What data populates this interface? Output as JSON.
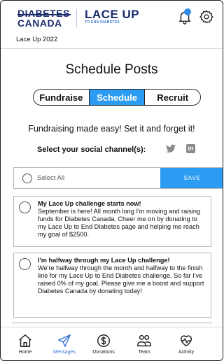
{
  "header": {
    "logo_diabetes_line1": "DIABETES",
    "logo_diabetes_line2": "CANADA",
    "logo_laceup_line1": "LACE UP",
    "logo_laceup_line2": "TO END DIABETES",
    "event_name": "Lace Up 2022",
    "notification_badge": true
  },
  "page": {
    "title": "Schedule Posts",
    "tabs": [
      {
        "label": "Fundraise",
        "active": false
      },
      {
        "label": "Schedule",
        "active": true
      },
      {
        "label": "Recruit",
        "active": false
      }
    ],
    "tagline": "Fundraising made easy! Set it and forget it!",
    "channels_label": "Select your social channel(s):",
    "channels": [
      {
        "icon": "twitter-icon",
        "selected": false
      },
      {
        "icon": "linkedin-icon",
        "label": "in",
        "selected": false
      }
    ]
  },
  "select_bar": {
    "select_all_label": "Select All",
    "save_label": "SAVE"
  },
  "posts": [
    {
      "title": "My Lace Up challenge starts now!",
      "body": "September is here! All month long I'm moving and raising funds for Diabetes Canada. Cheer me on by donating to my Lace Up to End Diabetes page and helping me reach my goal of $2500."
    },
    {
      "title": "I'm halfway through my Lace Up challenge!",
      "body": "We're halfway through the month and halfway to the finish line for my Lace Up to End Diabetes challenge. So far I've raised 0% of my goal. Please give me a boost and support Diabetes Canada by donating today!"
    },
    {
      "title": "",
      "body": ""
    }
  ],
  "bottom_nav": [
    {
      "label": "Home",
      "icon": "home-icon",
      "active": false
    },
    {
      "label": "Messages",
      "icon": "send-icon",
      "active": true
    },
    {
      "label": "Donations",
      "icon": "dollar-icon",
      "active": false
    },
    {
      "label": "Team",
      "icon": "team-icon",
      "active": false
    },
    {
      "label": "Activity",
      "icon": "heart-pulse-icon",
      "active": false
    }
  ],
  "colors": {
    "accent": "#2b9cf2",
    "brand_navy": "#1a2b6d",
    "nav_active": "#3a76d6"
  }
}
